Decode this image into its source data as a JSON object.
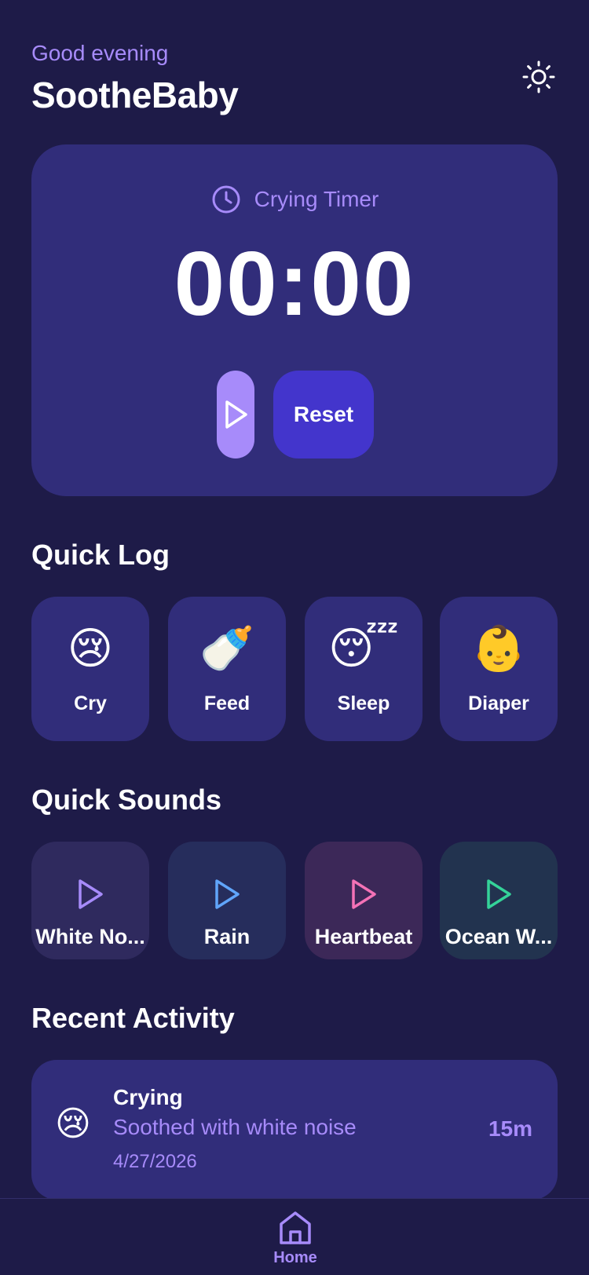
{
  "header": {
    "greeting": "Good evening",
    "app_title": "SootheBaby",
    "theme_icon": "sun-icon"
  },
  "timer": {
    "label": "Crying Timer",
    "icon": "clock-icon",
    "display": "00:00",
    "play_icon": "play-icon",
    "reset_label": "Reset"
  },
  "quick_log": {
    "title": "Quick Log",
    "items": [
      {
        "emoji": "😢",
        "label": "Cry"
      },
      {
        "emoji": "🍼",
        "label": "Feed"
      },
      {
        "emoji": "😴",
        "label": "Sleep"
      },
      {
        "emoji": "👶",
        "label": "Diaper"
      }
    ]
  },
  "quick_sounds": {
    "title": "Quick Sounds",
    "items": [
      {
        "label": "White No...",
        "color": "#a78bfa",
        "bg": "#2f2a5e"
      },
      {
        "label": "Rain",
        "color": "#60a5fa",
        "bg": "#262d5c"
      },
      {
        "label": "Heartbeat",
        "color": "#f472b6",
        "bg": "#3c2858"
      },
      {
        "label": "Ocean W...",
        "color": "#34d399",
        "bg": "#22334f"
      }
    ]
  },
  "recent_activity": {
    "title": "Recent Activity",
    "items": [
      {
        "emoji": "😢",
        "type": "Crying",
        "note": "Soothed with white noise",
        "date": "4/27/2026",
        "duration": "15m"
      }
    ]
  },
  "nav": {
    "home_label": "Home",
    "home_icon": "home-icon"
  },
  "colors": {
    "background": "#1e1b48",
    "card": "#312d7a",
    "accent": "#a78bfa",
    "button": "#4335cc"
  }
}
